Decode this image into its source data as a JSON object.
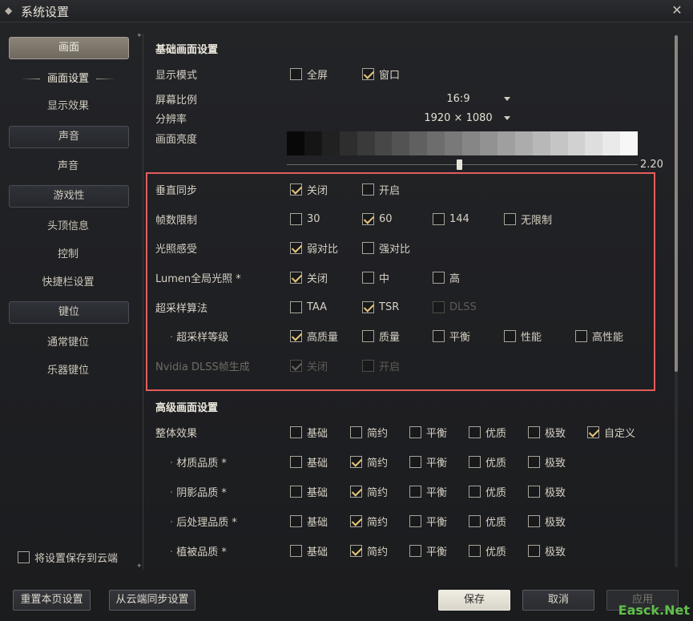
{
  "window": {
    "title": "系统设置"
  },
  "sidebar": {
    "categories": [
      {
        "label": "画面",
        "items": [
          "画面设置",
          "显示效果"
        ]
      },
      {
        "label": "声音",
        "items": [
          "声音"
        ]
      },
      {
        "label": "游戏性",
        "items": [
          "头顶信息",
          "控制",
          "快捷栏设置"
        ]
      },
      {
        "label": "键位",
        "items": [
          "通常键位",
          "乐器键位"
        ]
      }
    ],
    "cloud_save_label": "将设置保存到云端"
  },
  "basic": {
    "title": "基础画面设置",
    "display_mode": {
      "label": "显示模式",
      "options": [
        {
          "label": "全屏",
          "checked": false
        },
        {
          "label": "窗口",
          "checked": true
        }
      ]
    },
    "aspect_ratio": {
      "label": "屏幕比例",
      "value": "16:9"
    },
    "resolution": {
      "label": "分辨率",
      "value": "1920 × 1080"
    },
    "brightness": {
      "label": "画面亮度",
      "value": "2.20",
      "fraction": 0.49
    },
    "vsync": {
      "label": "垂直同步",
      "options": [
        {
          "label": "关闭",
          "checked": true
        },
        {
          "label": "开启",
          "checked": false
        }
      ]
    },
    "fps_limit": {
      "label": "帧数限制",
      "options": [
        {
          "label": "30",
          "checked": false
        },
        {
          "label": "60",
          "checked": true
        },
        {
          "label": "144",
          "checked": false
        },
        {
          "label": "无限制",
          "checked": false
        }
      ]
    },
    "light": {
      "label": "光照感受",
      "options": [
        {
          "label": "弱对比",
          "checked": true
        },
        {
          "label": "强对比",
          "checked": false
        }
      ]
    },
    "lumen": {
      "label": "Lumen全局光照 *",
      "options": [
        {
          "label": "关闭",
          "checked": true
        },
        {
          "label": "中",
          "checked": false
        },
        {
          "label": "高",
          "checked": false
        }
      ]
    },
    "upscale": {
      "label": "超采样算法",
      "options": [
        {
          "label": "TAA",
          "checked": false
        },
        {
          "label": "TSR",
          "checked": true
        },
        {
          "label": "DLSS",
          "checked": false,
          "disabled": true
        }
      ]
    },
    "upscale_level": {
      "label": "超采样等级",
      "options": [
        {
          "label": "高质量",
          "checked": true
        },
        {
          "label": "质量",
          "checked": false
        },
        {
          "label": "平衡",
          "checked": false
        },
        {
          "label": "性能",
          "checked": false
        },
        {
          "label": "高性能",
          "checked": false
        }
      ]
    },
    "dlss_fg": {
      "label": "Nvidia DLSS帧生成",
      "options": [
        {
          "label": "关闭",
          "checked": true
        },
        {
          "label": "开启",
          "checked": false
        }
      ]
    }
  },
  "advanced": {
    "title": "高级画面设置",
    "overall": {
      "label": "整体效果",
      "options": [
        {
          "label": "基础",
          "checked": false
        },
        {
          "label": "简约",
          "checked": false
        },
        {
          "label": "平衡",
          "checked": false
        },
        {
          "label": "优质",
          "checked": false
        },
        {
          "label": "极致",
          "checked": false
        },
        {
          "label": "自定义",
          "checked": true
        }
      ]
    },
    "rows": [
      {
        "label": "材质品质 *",
        "options": [
          {
            "label": "基础",
            "checked": false
          },
          {
            "label": "简约",
            "checked": true
          },
          {
            "label": "平衡",
            "checked": false
          },
          {
            "label": "优质",
            "checked": false
          },
          {
            "label": "极致",
            "checked": false
          }
        ]
      },
      {
        "label": "阴影品质 *",
        "options": [
          {
            "label": "基础",
            "checked": false
          },
          {
            "label": "简约",
            "checked": true
          },
          {
            "label": "平衡",
            "checked": false
          },
          {
            "label": "优质",
            "checked": false
          },
          {
            "label": "极致",
            "checked": false
          }
        ]
      },
      {
        "label": "后处理品质 *",
        "options": [
          {
            "label": "基础",
            "checked": false
          },
          {
            "label": "简约",
            "checked": true
          },
          {
            "label": "平衡",
            "checked": false
          },
          {
            "label": "优质",
            "checked": false
          },
          {
            "label": "极致",
            "checked": false
          }
        ]
      },
      {
        "label": "植被品质 *",
        "options": [
          {
            "label": "基础",
            "checked": false
          },
          {
            "label": "简约",
            "checked": true
          },
          {
            "label": "平衡",
            "checked": false
          },
          {
            "label": "优质",
            "checked": false
          },
          {
            "label": "极致",
            "checked": false
          }
        ]
      }
    ]
  },
  "footer": {
    "reset": "重置本页设置",
    "sync": "从云端同步设置",
    "save": "保存",
    "cancel": "取消",
    "apply": "应用"
  },
  "watermark": "Easck.Net",
  "colors": {
    "accent_check": "#e8c879",
    "highlight": "#e35d5d",
    "watermark": "#5fbf4a"
  }
}
